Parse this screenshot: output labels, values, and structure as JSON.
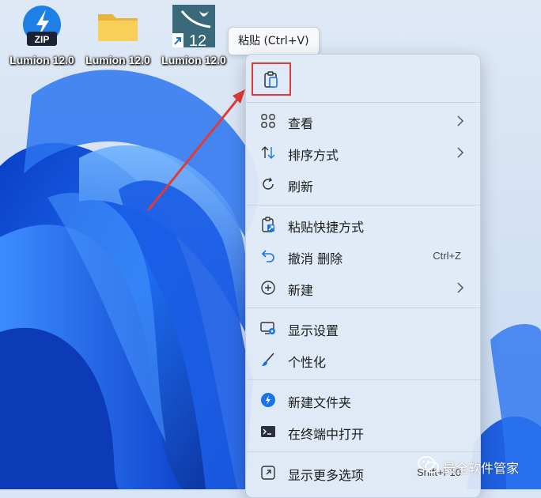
{
  "desktop": {
    "icons": [
      {
        "label": "Lumion 12.0",
        "type": "zip-archive",
        "badge": "ZIP"
      },
      {
        "label": "Lumion 12.0",
        "type": "folder"
      },
      {
        "label": "Lumion 12.0",
        "type": "lumion-shortcut",
        "badge": "12"
      }
    ]
  },
  "tooltip": {
    "text": "粘贴 (Ctrl+V)"
  },
  "context_menu": {
    "quick_actions": [
      {
        "name": "paste",
        "icon": "clipboard-icon",
        "highlighted": true
      }
    ],
    "items": [
      {
        "label": "查看",
        "icon": "grid-icon",
        "submenu": true
      },
      {
        "label": "排序方式",
        "icon": "sort-icon",
        "submenu": true
      },
      {
        "label": "刷新",
        "icon": "refresh-icon"
      },
      {
        "label": "粘贴快捷方式",
        "icon": "paste-shortcut-icon"
      },
      {
        "label": "撤消 删除",
        "icon": "undo-icon",
        "shortcut": "Ctrl+Z"
      },
      {
        "label": "新建",
        "icon": "plus-circle-icon",
        "submenu": true
      },
      {
        "label": "显示设置",
        "icon": "display-settings-icon"
      },
      {
        "label": "个性化",
        "icon": "brush-icon"
      },
      {
        "label": "新建文件夹",
        "icon": "new-folder-icon"
      },
      {
        "label": "在终端中打开",
        "icon": "terminal-icon"
      },
      {
        "label": "显示更多选项",
        "icon": "more-options-icon",
        "shortcut": "Shift+F10"
      }
    ]
  },
  "watermark": {
    "text": "最全软件管家"
  },
  "colors": {
    "highlight_box": "#e23a36",
    "arrow": "#e23a36",
    "wallpaper_blue": "#1f5fe0",
    "menu_bg": "#e1ebf7"
  }
}
